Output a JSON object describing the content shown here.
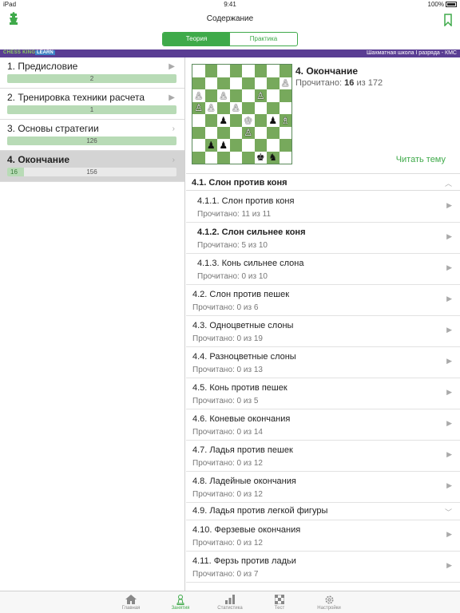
{
  "status": {
    "device": "iPad",
    "time": "9:41",
    "battery": "100%"
  },
  "nav": {
    "title": "Содержание"
  },
  "segment": {
    "theory": "Теория",
    "practice": "Практика"
  },
  "banner": {
    "logo": "CHESS KING",
    "learn": "LEARN",
    "text": "Шахматная школа I разряда - КМС"
  },
  "chapters": [
    {
      "title": "1. Предисловие",
      "value": "2",
      "progress": 1.0
    },
    {
      "title": "2. Тренировка техники расчета",
      "value": "1",
      "progress": 1.0
    },
    {
      "title": "3. Основы стратегии",
      "value": "126",
      "progress": 1.0
    },
    {
      "title": "4. Окончание",
      "read": "16",
      "total": "156",
      "progress": 0.1
    }
  ],
  "board": [
    "........",
    ".......P",
    "P.P..P..",
    "PP.P....",
    "..p.K.pB",
    "....P...",
    ".pp.....",
    ".....kn."
  ],
  "topic": {
    "title": "4. Окончание",
    "read_label": "Прочитано:",
    "read": "16",
    "of": "из",
    "total": "172",
    "read_button": "Читать тему"
  },
  "section": {
    "title": "4.1. Слон против коня"
  },
  "items": [
    {
      "title": "4.1.1. Слон против коня",
      "sub": "Прочитано: 11 из 11"
    },
    {
      "title": "4.1.2. Слон сильнее коня",
      "sub": "Прочитано: 5 из 10"
    },
    {
      "title": "4.1.3. Конь сильнее слона",
      "sub": "Прочитано: 0 из 10"
    },
    {
      "title": "4.2. Слон против пешек",
      "sub": "Прочитано: 0 из 6"
    },
    {
      "title": "4.3. Одноцветные слоны",
      "sub": "Прочитано: 0 из 19"
    },
    {
      "title": "4.4. Разноцветные слоны",
      "sub": "Прочитано: 0 из 13"
    },
    {
      "title": "4.5. Конь против пешек",
      "sub": "Прочитано: 0 из 5"
    },
    {
      "title": "4.6. Коневые окончания",
      "sub": "Прочитано: 0 из 14"
    },
    {
      "title": "4.7. Ладья против пешек",
      "sub": "Прочитано: 0 из 12"
    },
    {
      "title": "4.8. Ладейные окончания",
      "sub": "Прочитано: 0 из 12"
    },
    {
      "title": "4.9. Ладья против легкой фигуры"
    },
    {
      "title": "4.10. Ферзевые окончания",
      "sub": "Прочитано: 0 из 12"
    },
    {
      "title": "4.11. Ферзь против ладьи",
      "sub": "Прочитано: 0 из 7"
    }
  ],
  "tabs": [
    {
      "label": "Главная",
      "icon": "home-icon"
    },
    {
      "label": "Занятия",
      "icon": "pawn-icon"
    },
    {
      "label": "Статистика",
      "icon": "bar-chart-icon"
    },
    {
      "label": "Тест",
      "icon": "chessboard-icon"
    },
    {
      "label": "Настройки",
      "icon": "gear-icon"
    }
  ],
  "colors": {
    "accent": "#3faa4a",
    "banner": "#5a3d93",
    "board_dark": "#77a95c"
  }
}
